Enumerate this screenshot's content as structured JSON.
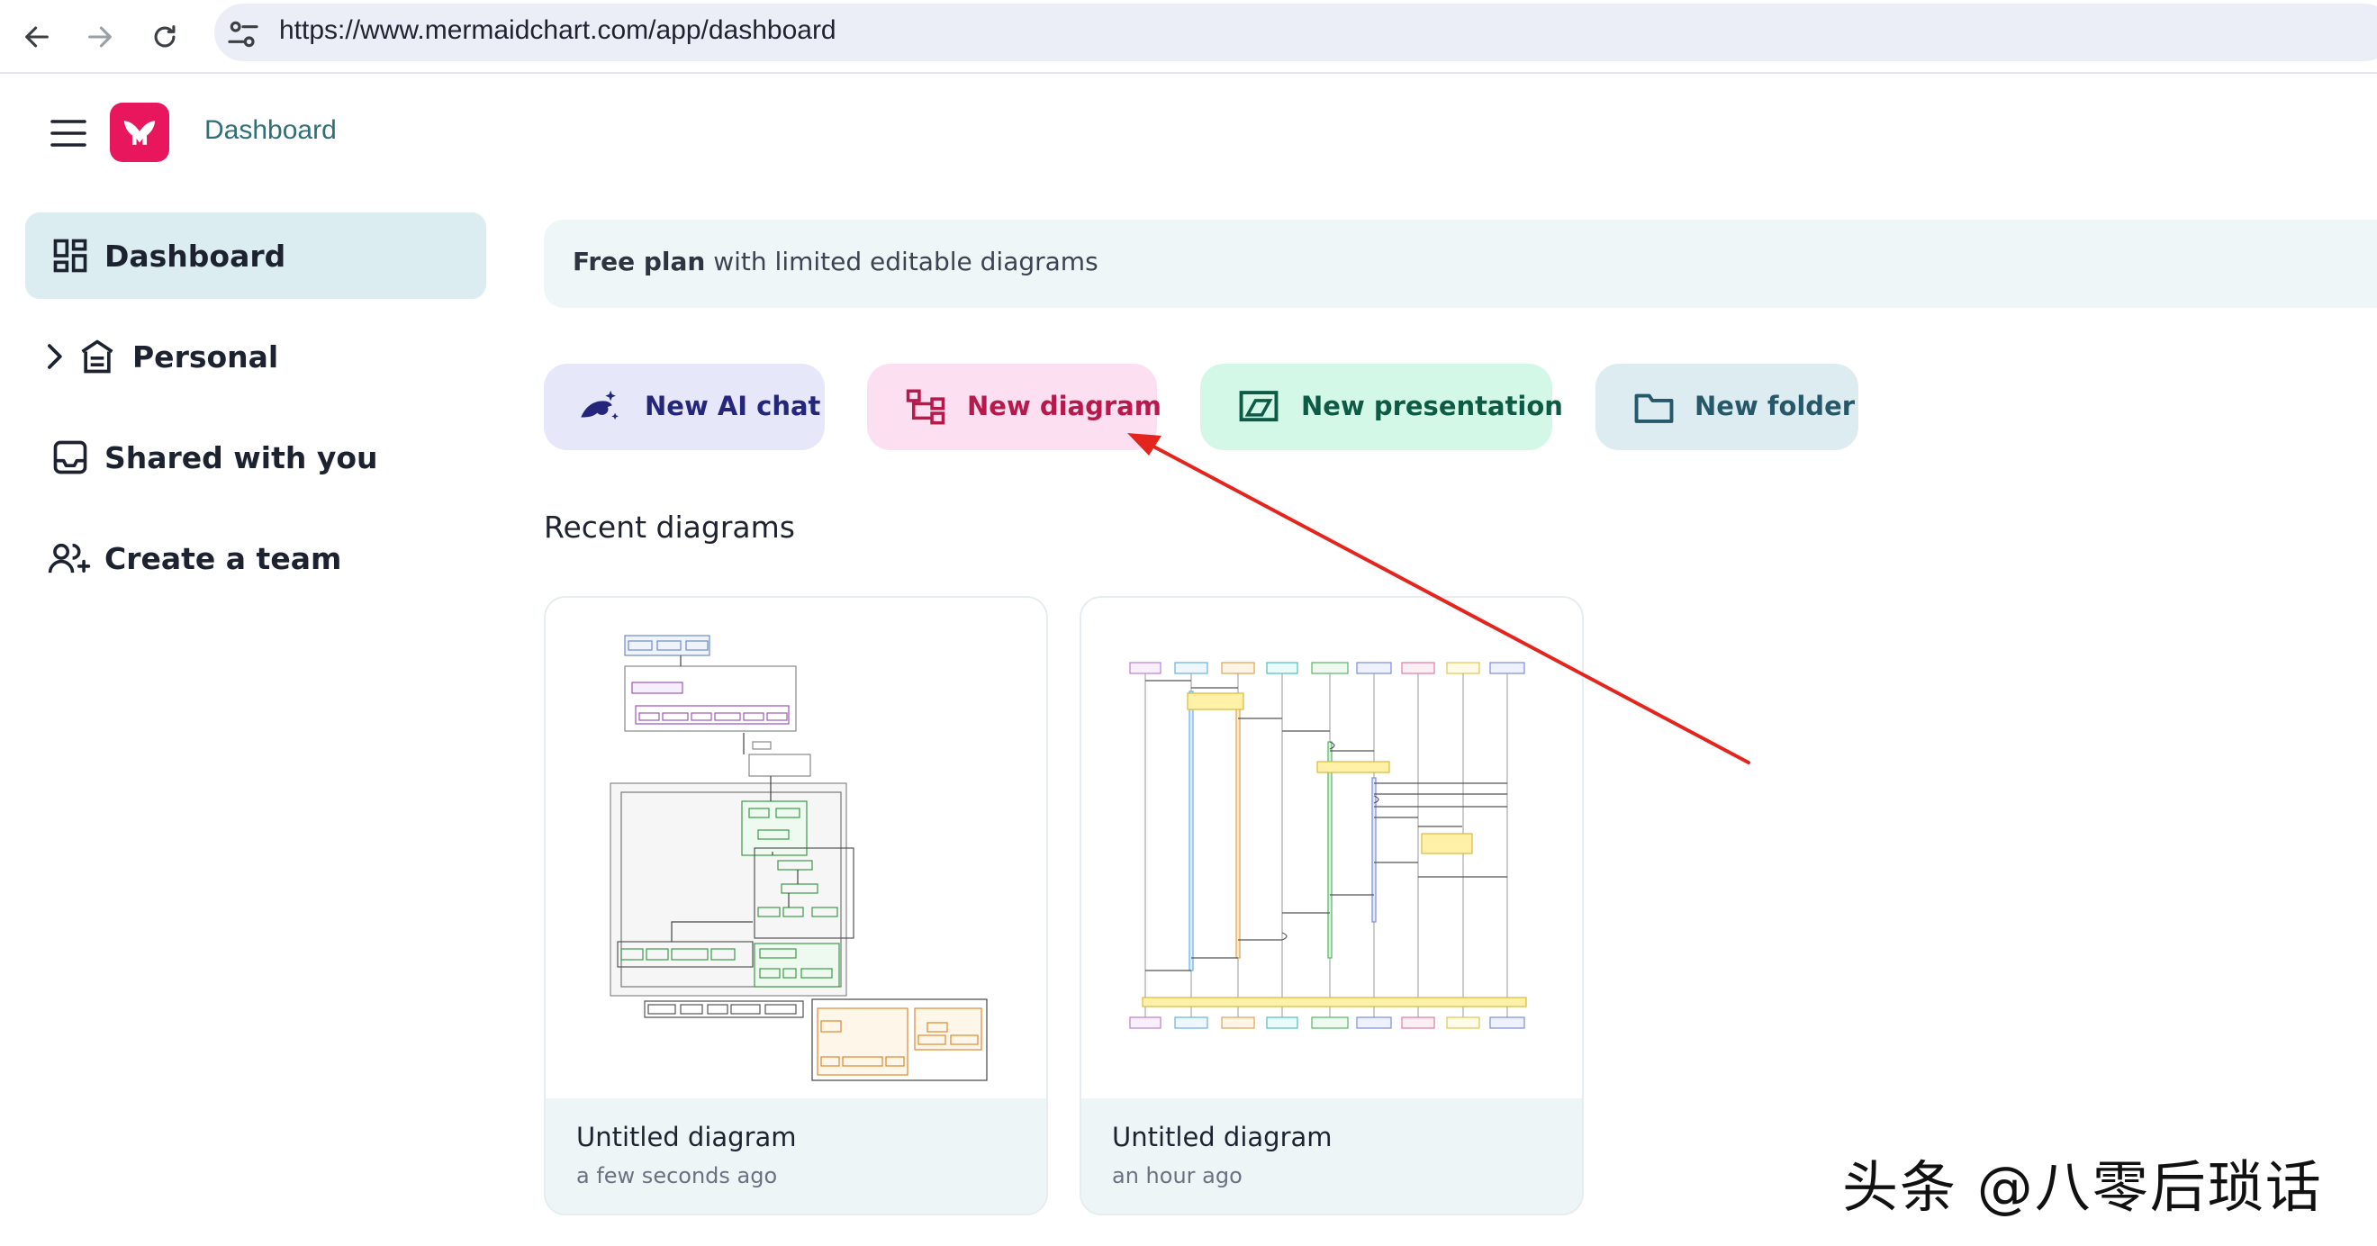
{
  "browser": {
    "url": "https://www.mermaidchart.com/app/dashboard",
    "back_icon": "arrow-left-icon",
    "forward_icon": "arrow-right-icon",
    "reload_icon": "reload-icon",
    "site_info_icon": "tune-icon"
  },
  "header": {
    "menu_icon": "hamburger-menu-icon",
    "logo_icon": "mermaid-logo-icon",
    "breadcrumb": "Dashboard"
  },
  "sidebar": {
    "items": [
      {
        "label": "Dashboard",
        "icon": "dashboard-grid-icon",
        "active": true
      },
      {
        "label": "Personal",
        "icon": "home-stack-icon",
        "expandable": true
      },
      {
        "label": "Shared with you",
        "icon": "inbox-icon"
      },
      {
        "label": "Create a team",
        "icon": "add-user-icon"
      }
    ]
  },
  "banner": {
    "bold": "Free plan",
    "rest": " with limited editable diagrams"
  },
  "actions": [
    {
      "label": "New AI chat",
      "icon": "ai-chat-icon",
      "bg": "#e6e7f8",
      "fg": "#23267a"
    },
    {
      "label": "New diagram",
      "icon": "diagram-icon",
      "bg": "#fcdff0",
      "fg": "#b8194b"
    },
    {
      "label": "New presentation",
      "icon": "presentation-icon",
      "bg": "#d3f8e8",
      "fg": "#0d5a45"
    },
    {
      "label": "New folder",
      "icon": "folder-icon",
      "bg": "#dcecf0",
      "fg": "#26586a"
    }
  ],
  "recent": {
    "title": "Recent diagrams",
    "items": [
      {
        "title": "Untitled diagram",
        "time": "a few seconds ago",
        "kind": "flowchart"
      },
      {
        "title": "Untitled diagram",
        "time": "an hour ago",
        "kind": "sequence"
      }
    ]
  },
  "colors": {
    "accent_pink": "#e8175d",
    "annotation_arrow": "#e3251d"
  },
  "watermark": "头条 @八零后琐话"
}
